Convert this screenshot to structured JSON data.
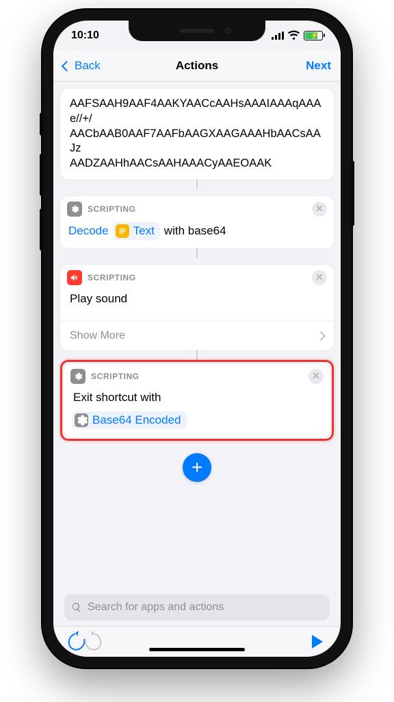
{
  "status": {
    "time": "10:10"
  },
  "nav": {
    "back": "Back",
    "title": "Actions",
    "next": "Next"
  },
  "textBlock": "AAFSAAH9AAF4AAKYAACcAAHsAAAIAAAqAAAe//+/\nAACbAAB0AAF7AAFbAAGXAAGAAAHbAACsAAJz\nAADZAAHhAACsAAHAAACyAAEOAAK",
  "actions": {
    "decode": {
      "category": "SCRIPTING",
      "verb": "Decode",
      "tokenLabel": "Text",
      "suffix": "with base64"
    },
    "playSound": {
      "category": "SCRIPTING",
      "title": "Play sound",
      "showMore": "Show More"
    },
    "exit": {
      "category": "SCRIPTING",
      "prefix": "Exit shortcut with",
      "tokenLabel": "Base64 Encoded"
    }
  },
  "search": {
    "placeholder": "Search for apps and actions"
  }
}
